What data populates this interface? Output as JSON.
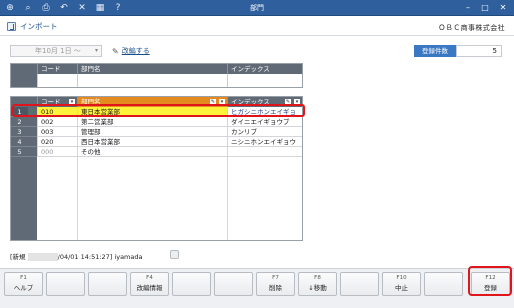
{
  "window": {
    "title": "部門",
    "toolbar_icons": [
      "add-icon",
      "search-icon",
      "print-icon",
      "undo-icon",
      "delete-icon",
      "excel-icon",
      "help-icon"
    ],
    "controls": [
      "minimize-icon",
      "maximize-icon",
      "close-icon"
    ]
  },
  "subbar": {
    "import_label": "インポート",
    "company": "ＯＢＣ商事株式会社"
  },
  "filter": {
    "date_value": "年10月 1日 ～",
    "edit_link": "改編する",
    "count_label": "登録件数",
    "count_value": "5"
  },
  "filter_grid": {
    "headers": [
      "コード",
      "部門名",
      "インデックス"
    ]
  },
  "grid": {
    "headers": [
      "コード",
      "部門名",
      "インデックス"
    ],
    "rows": [
      {
        "num": "1",
        "code": "010",
        "name": "東日本営業部",
        "index": "ヒガシニホンエイギョ"
      },
      {
        "num": "2",
        "code": "002",
        "name": "第二営業部",
        "index": "ダイニエイギョウブ"
      },
      {
        "num": "3",
        "code": "003",
        "name": "管理部",
        "index": "カンリブ"
      },
      {
        "num": "4",
        "code": "020",
        "name": "西日本営業部",
        "index": "ニシニホンエイギョウ"
      },
      {
        "num": "5",
        "code": "000",
        "name": "その他",
        "index": ""
      }
    ]
  },
  "status": {
    "prefix": "[新規",
    "timestamp": "/04/01 14:51:27]",
    "user": "iyamada"
  },
  "fkeys": [
    {
      "key": "F1",
      "label": "ヘルプ"
    },
    {
      "key": "",
      "label": ""
    },
    {
      "key": "",
      "label": ""
    },
    {
      "key": "F4",
      "label": "改編情報"
    },
    {
      "key": "",
      "label": ""
    },
    {
      "key": "",
      "label": ""
    },
    {
      "key": "F7",
      "label": "削除"
    },
    {
      "key": "F8",
      "label": "↓移動"
    },
    {
      "key": "",
      "label": ""
    },
    {
      "key": "F10",
      "label": "中止"
    },
    {
      "key": "",
      "label": ""
    },
    {
      "key": "F12",
      "label": "登録"
    }
  ],
  "colors": {
    "titlebar": "#2f5f9c",
    "header_orange": "#e58a1f",
    "selected_row": "#fff23a",
    "highlight_outline": "#e0141b"
  }
}
